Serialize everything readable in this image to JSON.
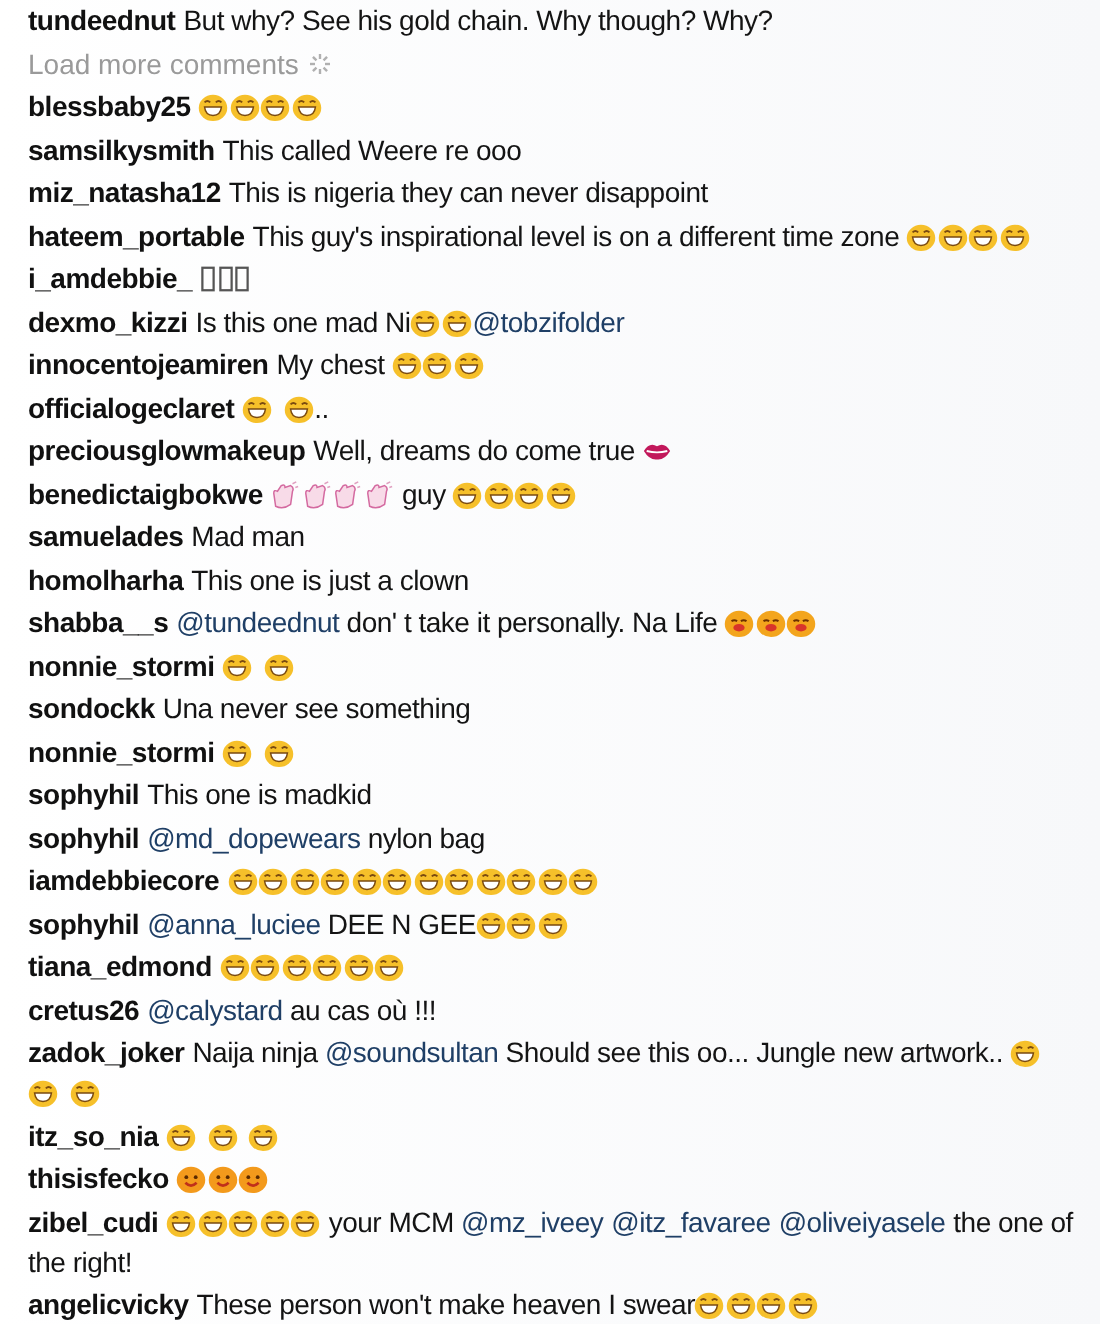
{
  "top_comment": {
    "user": "tundeednut",
    "parts": [
      {
        "kind": "text",
        "text": "But why? See his gold chain. Why though? Why?"
      }
    ]
  },
  "load_more": {
    "label": "Load more comments"
  },
  "comments": [
    {
      "user": "blessbaby25",
      "parts": [
        {
          "kind": "laugh"
        },
        {
          "kind": "laugh"
        },
        {
          "kind": "laugh"
        },
        {
          "kind": "laugh"
        }
      ]
    },
    {
      "user": "samsilkysmith",
      "parts": [
        {
          "kind": "text",
          "text": "This called Weere re ooo"
        }
      ]
    },
    {
      "user": "miz_natasha12",
      "parts": [
        {
          "kind": "text",
          "text": "This is nigeria they can never disappoint"
        }
      ]
    },
    {
      "user": "hateem_portable",
      "parts": [
        {
          "kind": "text",
          "text": "This guy's inspirational level is on a different time zone "
        },
        {
          "kind": "laugh"
        },
        {
          "kind": "laugh"
        },
        {
          "kind": "laugh"
        },
        {
          "kind": "laugh"
        }
      ]
    },
    {
      "user": "i_amdebbie_",
      "parts": [
        {
          "kind": "missing"
        },
        {
          "kind": "missing"
        },
        {
          "kind": "missing"
        }
      ]
    },
    {
      "user": "dexmo_kizzi",
      "parts": [
        {
          "kind": "text",
          "text": "Is this one mad Ni"
        },
        {
          "kind": "laugh"
        },
        {
          "kind": "laugh"
        },
        {
          "kind": "mention",
          "text": "@tobzifolder"
        }
      ]
    },
    {
      "user": "innocentojeamiren",
      "parts": [
        {
          "kind": "text",
          "text": "My chest "
        },
        {
          "kind": "laugh"
        },
        {
          "kind": "laugh"
        },
        {
          "kind": "laugh"
        }
      ]
    },
    {
      "user": "officialogeclaret",
      "parts": [
        {
          "kind": "laugh",
          "space_after": true
        },
        {
          "kind": "laugh"
        },
        {
          "kind": "text",
          "text": ".."
        }
      ]
    },
    {
      "user": "preciousglowmakeup",
      "parts": [
        {
          "kind": "text",
          "text": "Well, dreams do come true "
        },
        {
          "kind": "kiss"
        }
      ]
    },
    {
      "user": "benedictaigbokwe",
      "parts": [
        {
          "kind": "clap"
        },
        {
          "kind": "clap"
        },
        {
          "kind": "clap"
        },
        {
          "kind": "clap"
        },
        {
          "kind": "text",
          "text": " guy "
        },
        {
          "kind": "laugh"
        },
        {
          "kind": "laugh"
        },
        {
          "kind": "laugh"
        },
        {
          "kind": "laugh"
        }
      ]
    },
    {
      "user": "samuelades",
      "parts": [
        {
          "kind": "text",
          "text": "Mad man"
        }
      ]
    },
    {
      "user": "homolharha",
      "parts": [
        {
          "kind": "text",
          "text": "This one is just a clown"
        }
      ]
    },
    {
      "user": "shabba__s",
      "parts": [
        {
          "kind": "mention",
          "text": "@tundeednut"
        },
        {
          "kind": "text",
          "text": " don' t take it personally. Na Life "
        },
        {
          "kind": "blush"
        },
        {
          "kind": "blush"
        },
        {
          "kind": "blush"
        }
      ]
    },
    {
      "user": "nonnie_stormi",
      "parts": [
        {
          "kind": "laugh",
          "space_after": true
        },
        {
          "kind": "laugh"
        }
      ]
    },
    {
      "user": "sondockk",
      "parts": [
        {
          "kind": "text",
          "text": "Una never see something"
        }
      ]
    },
    {
      "user": "nonnie_stormi",
      "parts": [
        {
          "kind": "laugh",
          "space_after": true
        },
        {
          "kind": "laugh"
        }
      ]
    },
    {
      "user": "sophyhil",
      "parts": [
        {
          "kind": "text",
          "text": "This one is madkid"
        }
      ]
    },
    {
      "user": "sophyhil",
      "parts": [
        {
          "kind": "mention",
          "text": "@md_dopewears"
        },
        {
          "kind": "text",
          "text": " nylon bag"
        }
      ]
    },
    {
      "user": "iamdebbiecore",
      "parts": [
        {
          "kind": "laugh"
        },
        {
          "kind": "laugh"
        },
        {
          "kind": "laugh"
        },
        {
          "kind": "laugh"
        },
        {
          "kind": "laugh"
        },
        {
          "kind": "laugh"
        },
        {
          "kind": "laugh"
        },
        {
          "kind": "laugh"
        },
        {
          "kind": "laugh"
        },
        {
          "kind": "laugh"
        },
        {
          "kind": "laugh"
        },
        {
          "kind": "laugh"
        }
      ]
    },
    {
      "user": "sophyhil",
      "parts": [
        {
          "kind": "mention",
          "text": "@anna_luciee"
        },
        {
          "kind": "text",
          "text": " DEE N GEE"
        },
        {
          "kind": "laugh"
        },
        {
          "kind": "laugh"
        },
        {
          "kind": "laugh"
        }
      ]
    },
    {
      "user": "tiana_edmond",
      "parts": [
        {
          "kind": "laugh"
        },
        {
          "kind": "laugh"
        },
        {
          "kind": "laugh"
        },
        {
          "kind": "laugh"
        },
        {
          "kind": "laugh"
        },
        {
          "kind": "laugh"
        }
      ]
    },
    {
      "user": "cretus26",
      "parts": [
        {
          "kind": "mention",
          "text": "@calystard"
        },
        {
          "kind": "text",
          "text": " au cas où !!!"
        }
      ]
    },
    {
      "user": "zadok_joker",
      "parts": [
        {
          "kind": "text",
          "text": "Naija ninja "
        },
        {
          "kind": "mention",
          "text": "@soundsultan"
        },
        {
          "kind": "text",
          "text": " Should see this oo... Jungle new artwork.. "
        },
        {
          "kind": "laugh",
          "space_after": true
        },
        {
          "kind": "laugh",
          "space_after": true
        },
        {
          "kind": "laugh"
        }
      ]
    },
    {
      "user": "itz_so_nia",
      "parts": [
        {
          "kind": "laugh",
          "space_after": true
        },
        {
          "kind": "laugh",
          "space_after": true
        },
        {
          "kind": "laugh"
        }
      ]
    },
    {
      "user": "thisisfecko",
      "parts": [
        {
          "kind": "smile"
        },
        {
          "kind": "smile"
        },
        {
          "kind": "smile"
        }
      ]
    },
    {
      "user": "zibel_cudi",
      "parts": [
        {
          "kind": "laugh"
        },
        {
          "kind": "laugh"
        },
        {
          "kind": "laugh"
        },
        {
          "kind": "laugh"
        },
        {
          "kind": "laugh"
        },
        {
          "kind": "text",
          "text": " your MCM "
        },
        {
          "kind": "mention",
          "text": "@mz_iveey",
          "space_after": true
        },
        {
          "kind": "mention",
          "text": "@itz_favaree",
          "space_after": true
        },
        {
          "kind": "mention",
          "text": "@oliveiyasele",
          "space_after": true
        },
        {
          "kind": "text",
          "text": "the one of "
        },
        {
          "kind": "text",
          "text": "the right!"
        }
      ]
    },
    {
      "user": "angelicvicky",
      "parts": [
        {
          "kind": "text",
          "text": "These person won't make heaven I swear"
        },
        {
          "kind": "laugh"
        },
        {
          "kind": "laugh"
        },
        {
          "kind": "laugh"
        },
        {
          "kind": "laugh"
        }
      ]
    }
  ]
}
